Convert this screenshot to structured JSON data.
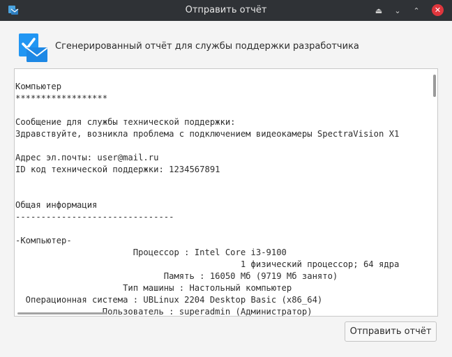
{
  "window": {
    "title": "Отправить отчёт"
  },
  "titlebar_buttons": {
    "shade": "⏏",
    "minimize": "⌄",
    "maximize": "⌃",
    "close": "✕"
  },
  "header": {
    "text": "Сгенерированный отчёт для службы поддержки разработчика"
  },
  "report": {
    "lines": [
      "Компьютер",
      "******************",
      "",
      "Сообщение для службы технической поддержки:",
      "Здравствуйте, возникла проблема с подключением видеокамеры SpectraVision X1",
      "",
      "Адрес эл.почты: user@mail.ru",
      "ID код технической поддержки: 1234567891",
      "",
      "",
      "Общая информация",
      "-------------------------------",
      "",
      "-Компьютер-",
      "                       Процессор : Intel Core i3-9100",
      "                                            1 физический процессор; 64 ядра",
      "                             Память : 16050 Мб (9719 Мб занято)",
      "                     Тип машины : Настольный компьютер",
      "  Операционная система : UBLinux 2204 Desktop Basic (x86_64)",
      "                 Пользователь : superadmin (Администратор)"
    ]
  },
  "buttons": {
    "send": "Отправить отчёт"
  },
  "colors": {
    "titlebar": "#2f3236",
    "close_button": "#e0363d",
    "window_bg": "#f4f4f4",
    "icon_blue": "#1e88e5"
  }
}
